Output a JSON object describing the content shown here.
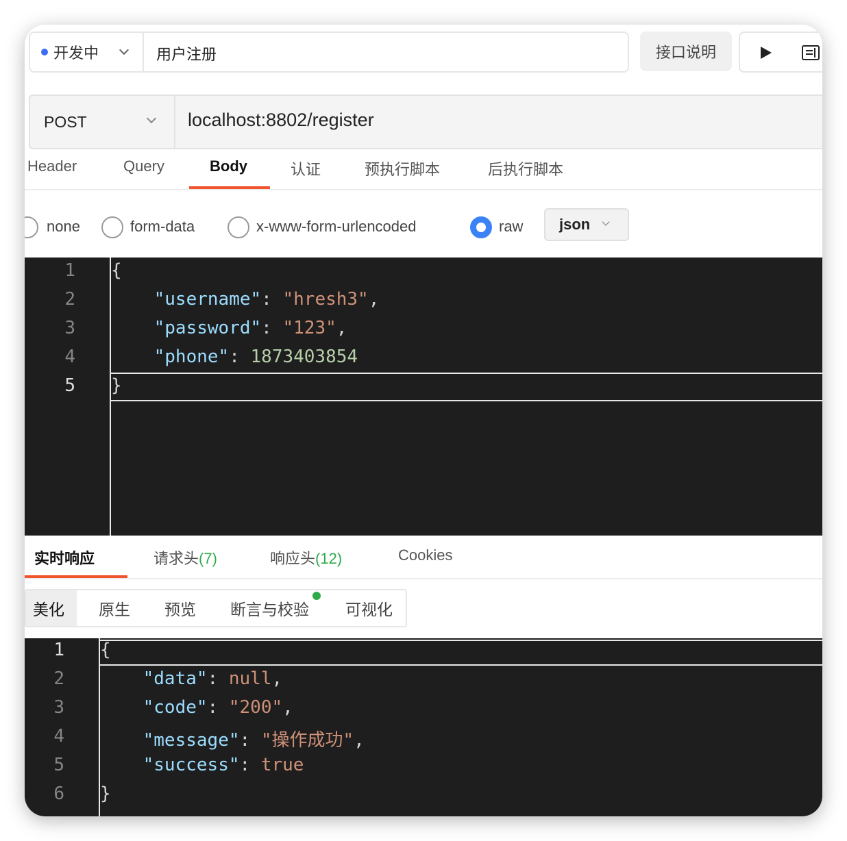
{
  "topbar": {
    "status": "开发中",
    "api_name": "用户注册",
    "doc_button": "接口说明"
  },
  "request": {
    "method": "POST",
    "url": "localhost:8802/register"
  },
  "request_tabs": [
    "Header",
    "Query",
    "Body",
    "认证",
    "预执行脚本",
    "后执行脚本"
  ],
  "active_request_tab": "Body",
  "body_types": [
    "none",
    "form-data",
    "x-www-form-urlencoded",
    "raw"
  ],
  "selected_body_type": "raw",
  "raw_format": "json",
  "request_body": {
    "line_numbers": [
      "1",
      "2",
      "3",
      "4",
      "5"
    ],
    "lines": [
      [
        {
          "t": "{",
          "c": "p"
        }
      ],
      [
        {
          "t": "    ",
          "c": "p"
        },
        {
          "t": "\"username\"",
          "c": "k"
        },
        {
          "t": ": ",
          "c": "p"
        },
        {
          "t": "\"hresh3\"",
          "c": "s"
        },
        {
          "t": ",",
          "c": "p"
        }
      ],
      [
        {
          "t": "    ",
          "c": "p"
        },
        {
          "t": "\"password\"",
          "c": "k"
        },
        {
          "t": ": ",
          "c": "p"
        },
        {
          "t": "\"123\"",
          "c": "s"
        },
        {
          "t": ",",
          "c": "p"
        }
      ],
      [
        {
          "t": "    ",
          "c": "p"
        },
        {
          "t": "\"phone\"",
          "c": "k"
        },
        {
          "t": ": ",
          "c": "p"
        },
        {
          "t": "1873403854",
          "c": "n"
        }
      ],
      [
        {
          "t": "}",
          "c": "p"
        }
      ]
    ]
  },
  "response_tabs": {
    "realtime": "实时响应",
    "req_headers": "请求头",
    "req_headers_count": "(7)",
    "resp_headers": "响应头",
    "resp_headers_count": "(12)",
    "cookies": "Cookies"
  },
  "view_modes": [
    "美化",
    "原生",
    "预览",
    "断言与校验",
    "可视化"
  ],
  "active_view_mode": "美化",
  "response_body": {
    "line_numbers": [
      "1",
      "2",
      "3",
      "4",
      "5",
      "6"
    ],
    "lines": [
      [
        {
          "t": "{",
          "c": "p"
        }
      ],
      [
        {
          "t": "    ",
          "c": "p"
        },
        {
          "t": "\"data\"",
          "c": "k"
        },
        {
          "t": ": ",
          "c": "p"
        },
        {
          "t": "null",
          "c": "s"
        },
        {
          "t": ",",
          "c": "p"
        }
      ],
      [
        {
          "t": "    ",
          "c": "p"
        },
        {
          "t": "\"code\"",
          "c": "k"
        },
        {
          "t": ": ",
          "c": "p"
        },
        {
          "t": "\"200\"",
          "c": "s"
        },
        {
          "t": ",",
          "c": "p"
        }
      ],
      [
        {
          "t": "    ",
          "c": "p"
        },
        {
          "t": "\"message\"",
          "c": "k"
        },
        {
          "t": ": ",
          "c": "p"
        },
        {
          "t": "\"操作成功\"",
          "c": "s"
        },
        {
          "t": ",",
          "c": "p"
        }
      ],
      [
        {
          "t": "    ",
          "c": "p"
        },
        {
          "t": "\"success\"",
          "c": "k"
        },
        {
          "t": ": ",
          "c": "p"
        },
        {
          "t": "true",
          "c": "s"
        }
      ],
      [
        {
          "t": "}",
          "c": "p"
        }
      ]
    ]
  },
  "colors": {
    "accent_underline": "#f0542d",
    "status_dot": "#3b6df5",
    "radio_checked": "#3b82f6",
    "count_green": "#2eaa4a",
    "editor_bg": "#1e1e1e"
  }
}
